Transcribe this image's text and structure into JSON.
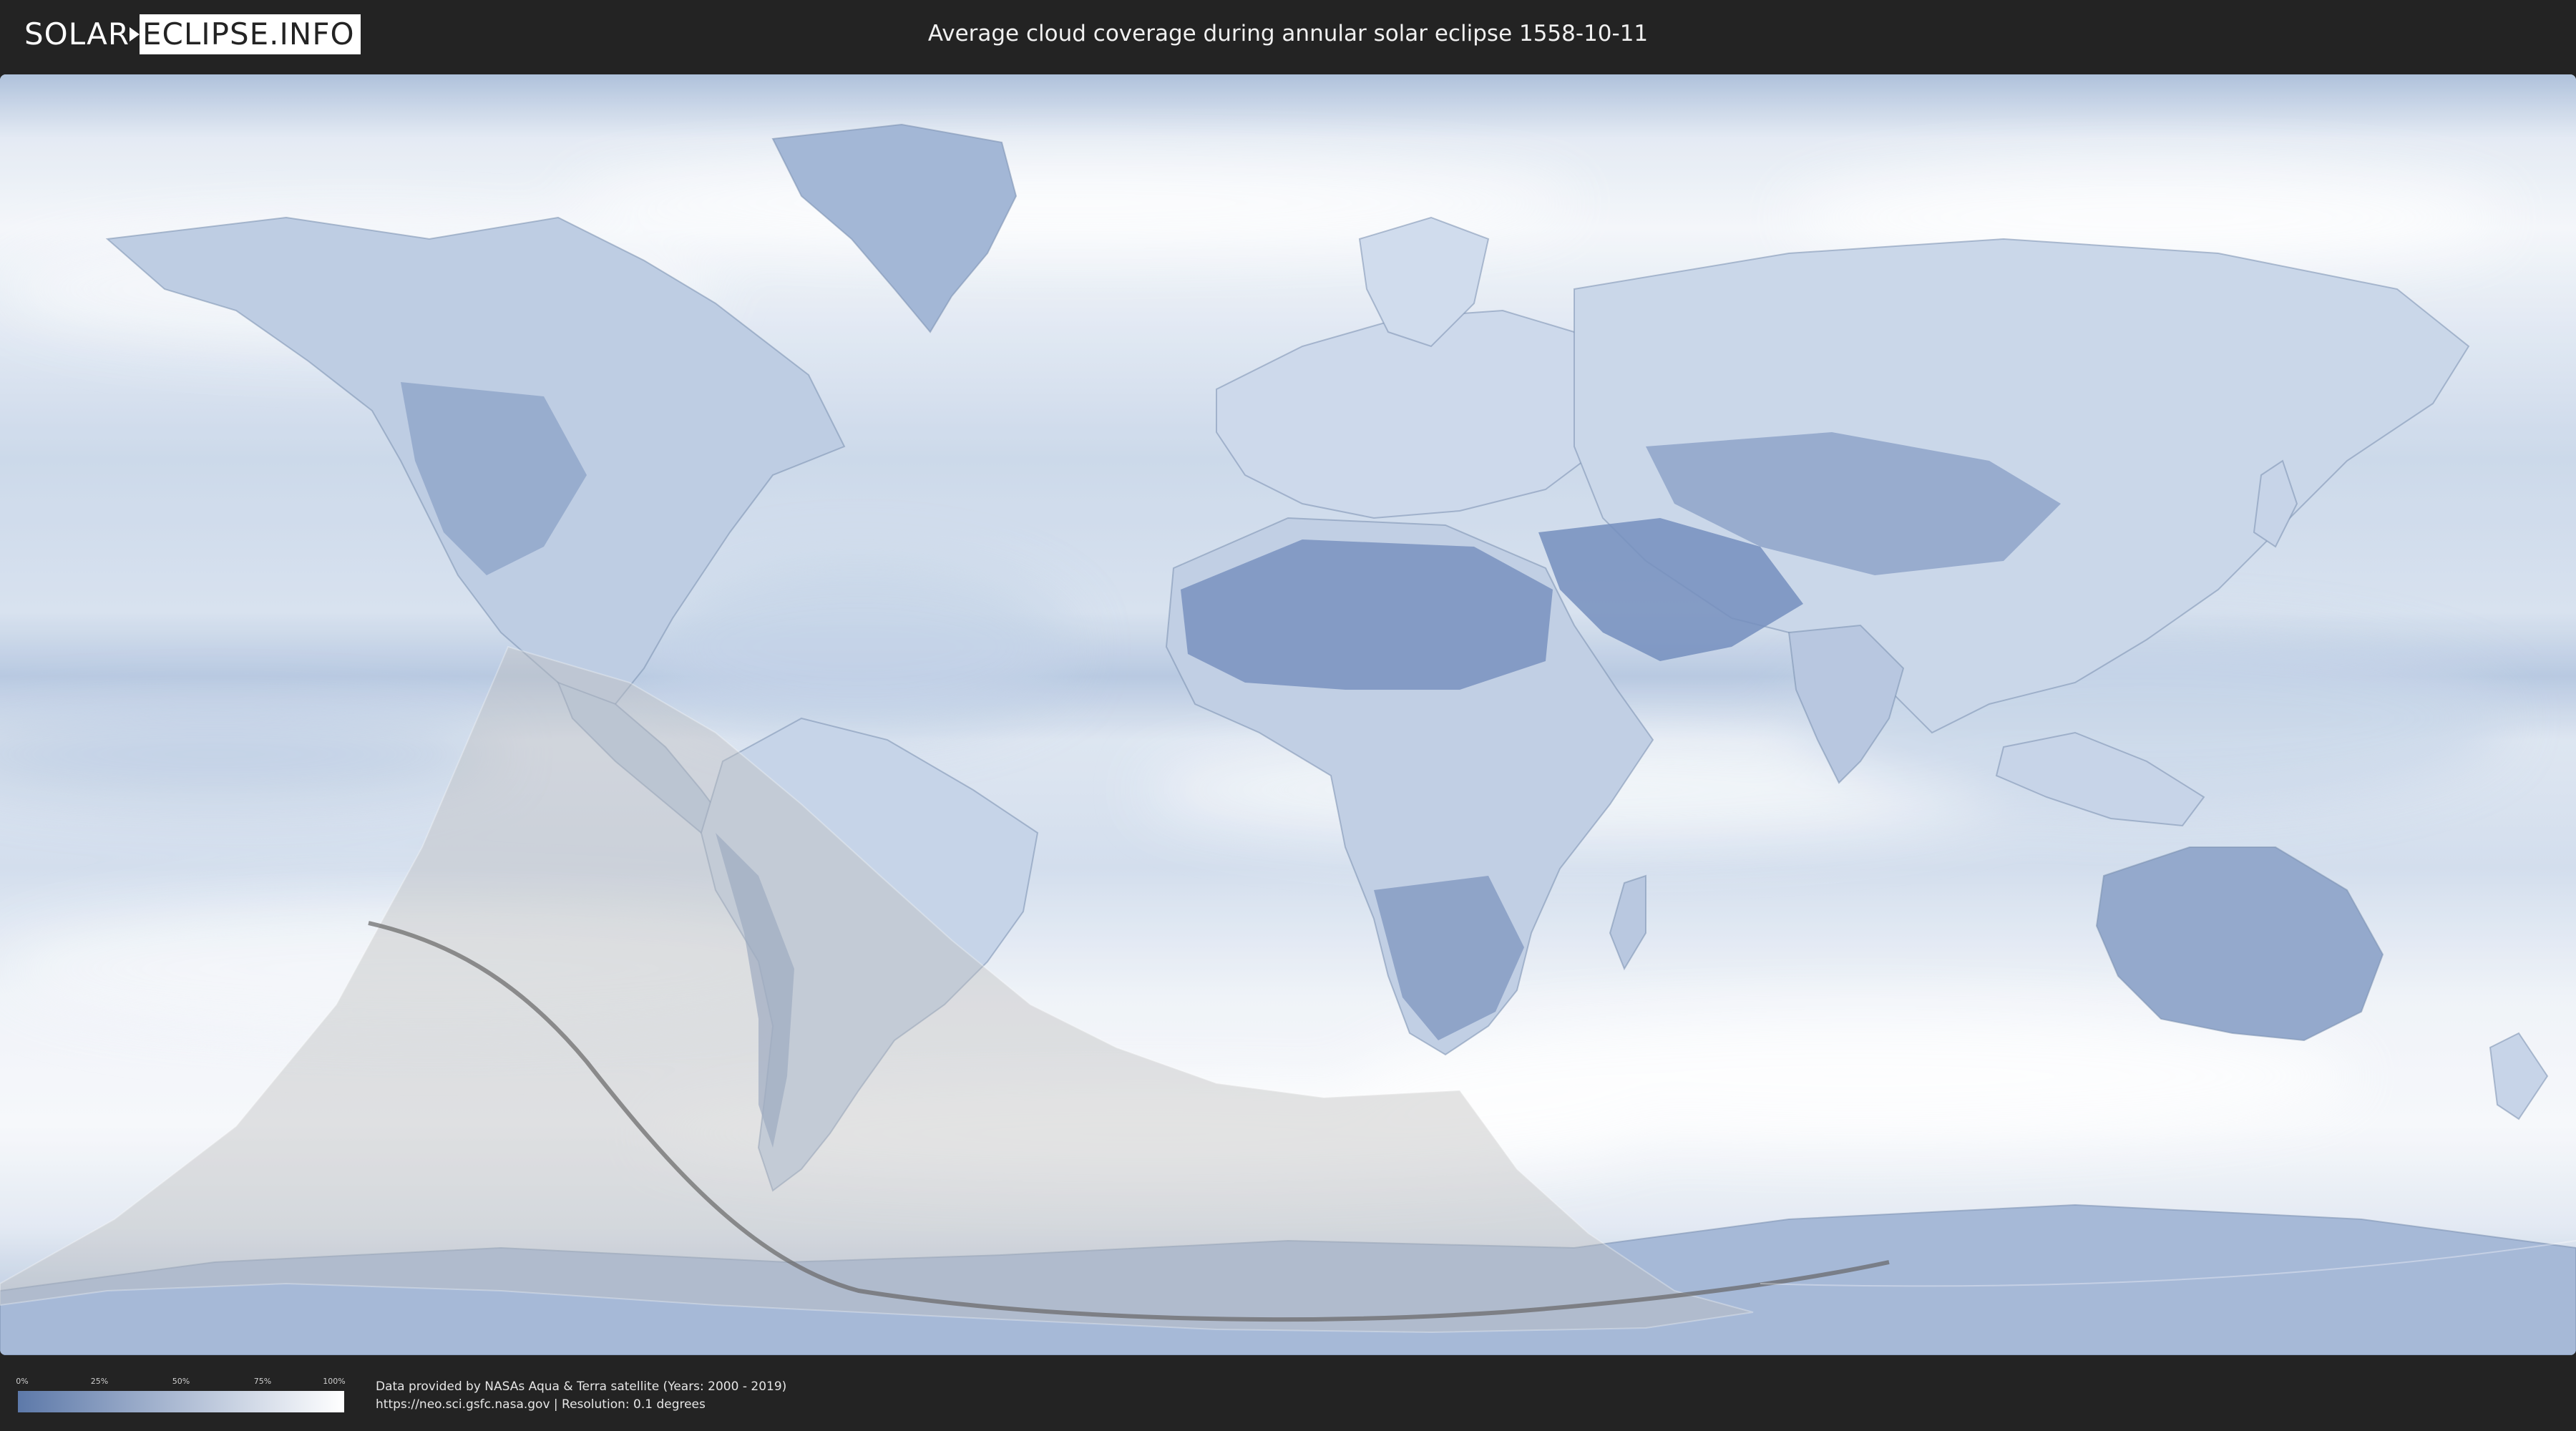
{
  "header": {
    "logo_left": "SOLAR",
    "logo_right": "ECLIPSE.INFO",
    "title": "Average cloud coverage during annular solar eclipse 1558-10-11"
  },
  "map": {
    "ocean_color": "#e4ebf4",
    "cloud_low_color": "#5a77a8",
    "cloud_high_color": "#ffffff",
    "eclipse_shade_color": "#b9b9b9",
    "central_path_color": "#5a5a5a"
  },
  "legend": {
    "ticks": [
      "0%",
      "25%",
      "50%",
      "75%",
      "100%"
    ],
    "gradient_start": "#5d79a9",
    "gradient_end": "#ffffff"
  },
  "footer": {
    "credit_line1": "Data provided by NASAs Aqua & Terra satellite (Years: 2000 - 2019)",
    "credit_line2": "https://neo.sci.gsfc.nasa.gov | Resolution: 0.1 degrees"
  }
}
